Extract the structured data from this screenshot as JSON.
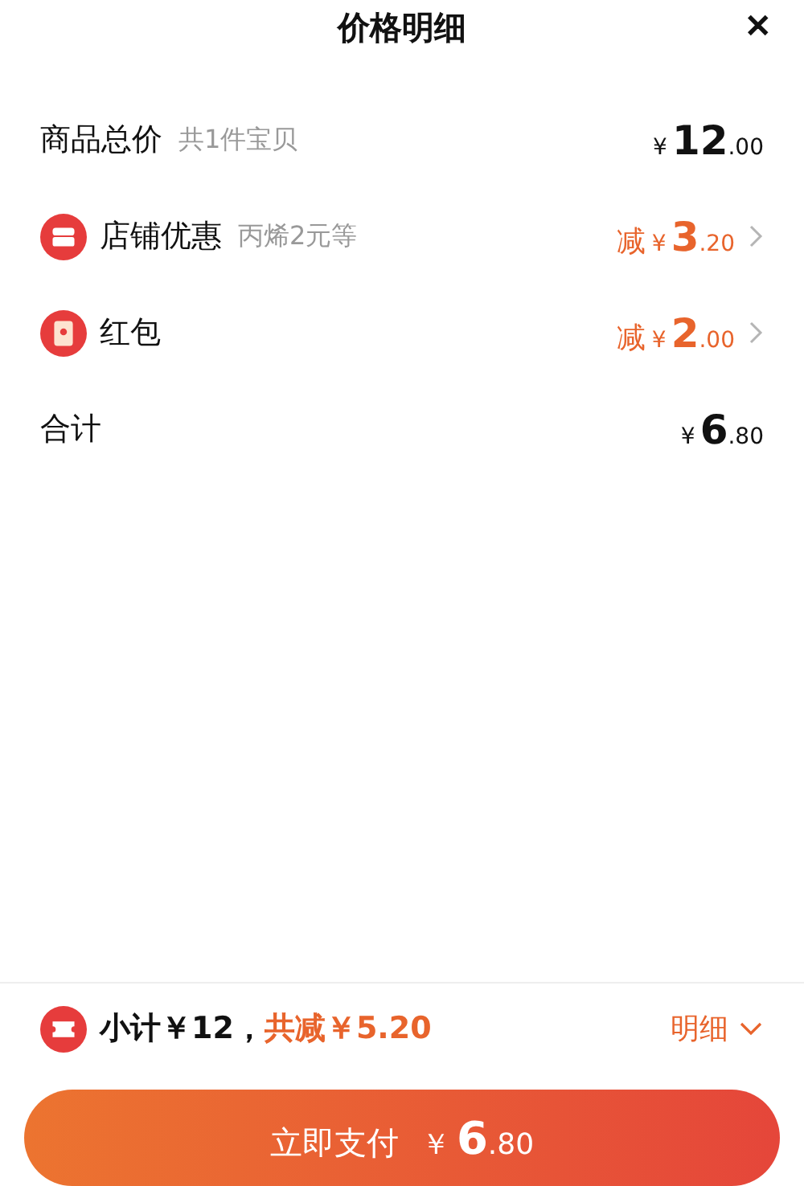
{
  "header": {
    "title": "价格明细",
    "close": "✕"
  },
  "rows": [
    {
      "kind": "plain",
      "label": "商品总价",
      "note": "共1件宝贝",
      "discount": false,
      "prefix": "",
      "currency": "¥",
      "integer": "12",
      "decimal": ".00",
      "arrow": false
    },
    {
      "kind": "shop",
      "label": "店铺优惠",
      "note": "丙烯2元等",
      "discount": true,
      "prefix": "减",
      "currency": "¥",
      "integer": "3",
      "decimal": ".20",
      "arrow": true
    },
    {
      "kind": "envelope",
      "label": "红包",
      "note": "",
      "discount": true,
      "prefix": "减",
      "currency": "¥",
      "integer": "2",
      "decimal": ".00",
      "arrow": true
    },
    {
      "kind": "plain",
      "label": "合计",
      "note": "",
      "discount": false,
      "prefix": "",
      "currency": "¥",
      "integer": "6",
      "decimal": ".80",
      "arrow": false
    }
  ],
  "summary": {
    "subtotal": "小计￥12，",
    "saving": "共减￥5.20",
    "details": "明细",
    "expanded": false
  },
  "pay_button": {
    "label": "立即支付",
    "currency": "￥",
    "integer": "6",
    "decimal": ".80"
  }
}
